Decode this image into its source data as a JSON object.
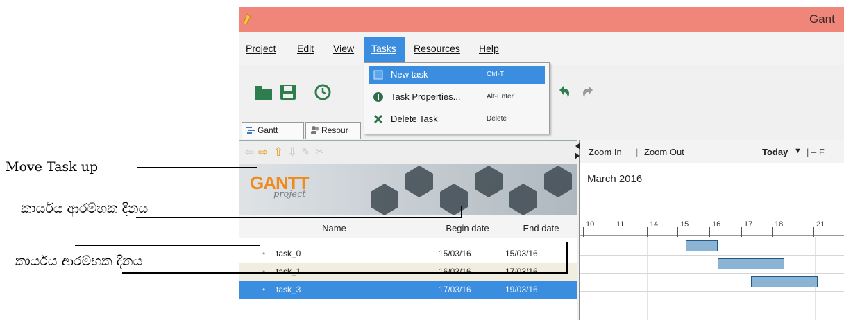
{
  "window": {
    "title": "Gant"
  },
  "menubar": {
    "items": [
      "Project",
      "Edit",
      "View",
      "Tasks",
      "Resources",
      "Help"
    ]
  },
  "tasks_menu": [
    {
      "label": "New task",
      "shortcut": "Ctrl-T",
      "icon": "new-task-icon"
    },
    {
      "label": "Task Properties...",
      "shortcut": "Alt-Enter",
      "icon": "info-icon"
    },
    {
      "label": "Delete Task",
      "shortcut": "Delete",
      "icon": "delete-icon"
    }
  ],
  "tabs": {
    "gantt": "Gantt",
    "resources": "Resour"
  },
  "banner": {
    "logo_main": "GANTT",
    "logo_sub": "project"
  },
  "table": {
    "columns": [
      "Name",
      "Begin date",
      "End date"
    ],
    "rows": [
      {
        "name": "task_0",
        "begin": "15/03/16",
        "end": "15/03/16"
      },
      {
        "name": "task_1",
        "begin": "16/03/16",
        "end": "17/03/16"
      },
      {
        "name": "task_3",
        "begin": "17/03/16",
        "end": "19/03/16"
      }
    ]
  },
  "chart": {
    "zoom_in": "Zoom In",
    "separator": "|",
    "zoom_out": "Zoom Out",
    "today": "Today",
    "month": "March 2016",
    "days": [
      "10",
      "11",
      "14",
      "15",
      "16",
      "17",
      "18",
      "21"
    ],
    "right_edge": "| – F"
  },
  "annotations": {
    "move_task_up": "Move Task up",
    "begin_date_label_1": "කාර්යය ආරම්භක දිනය",
    "begin_date_label_2": "කාර්යය ආරම්භක දිනය"
  },
  "colors": {
    "titlebar": "#f0857a",
    "selection": "#3b8de0",
    "bar": "#8bb4d4"
  }
}
